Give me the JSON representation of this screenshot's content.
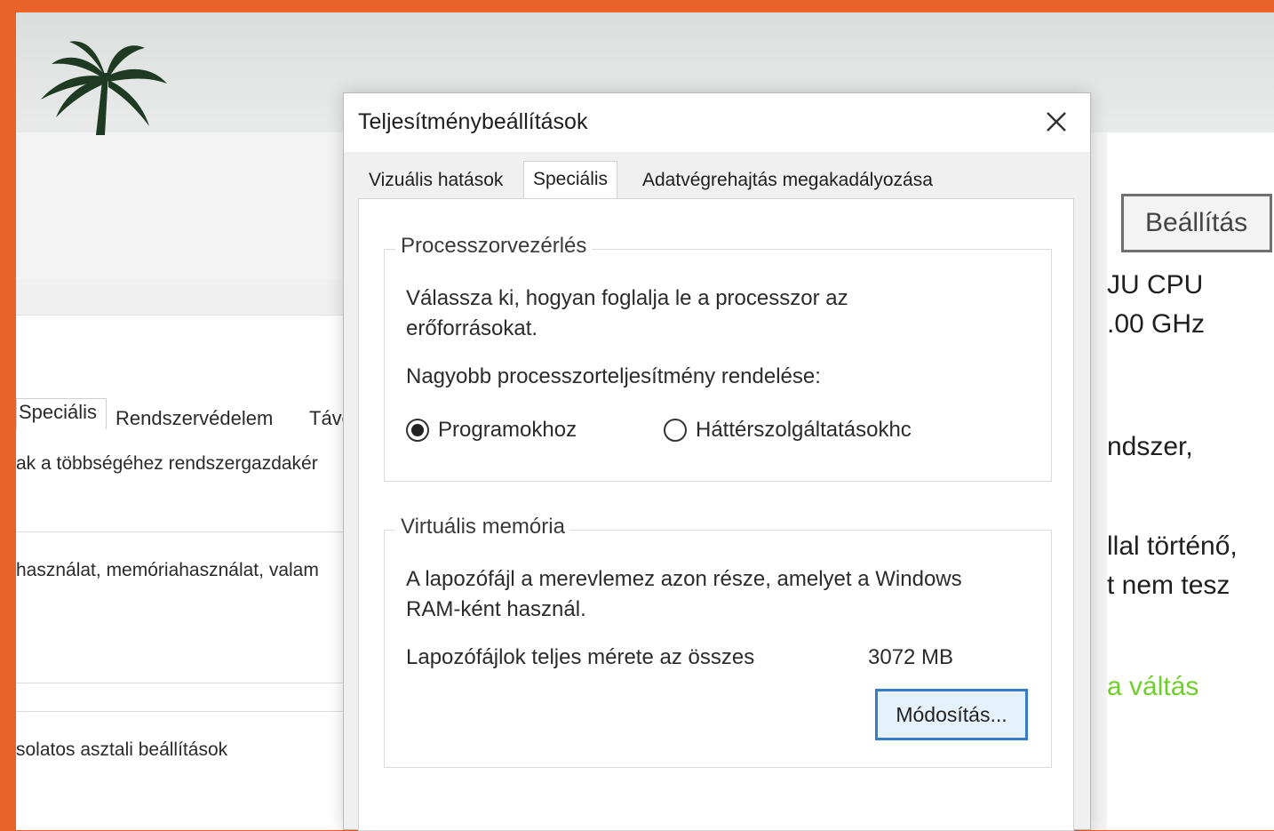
{
  "background": {
    "left_tabs": [
      "Speciális",
      "Rendszervédelem",
      "Távo"
    ],
    "left_lines": [
      "ak a többségéhez rendszergazdakér",
      "használat, memóriahasználat, valam",
      "solatos asztali beállítások"
    ],
    "right_button": "Beállítás",
    "right_lines": [
      "JU CPU",
      ".00 GHz",
      "ndszer,",
      "llal történő,",
      "t nem tesz",
      "a váltás"
    ],
    "accent_green": "#6fcf2a"
  },
  "dialog": {
    "title": "Teljesítménybeállítások",
    "tabs": [
      {
        "label": "Vizuális hatások",
        "active": false
      },
      {
        "label": "Speciális",
        "active": true
      },
      {
        "label": "Adatvégrehajtás megakadályozása",
        "active": false
      }
    ],
    "processor": {
      "legend": "Processzorvezérlés",
      "desc_line1": "Válassza ki, hogyan foglalja le a processzor az",
      "desc_line2": "erőforrásokat.",
      "question": "Nagyobb processzorteljesítmény rendelése:",
      "option_programs": "Programokhoz",
      "option_background": "Háttérszolgáltatásokhc",
      "selected": "Programokhoz"
    },
    "virtual_memory": {
      "legend": "Virtuális memória",
      "desc_line1": "A lapozófájl a merevlemez azon része, amelyet a Windows",
      "desc_line2": "RAM-ként használ.",
      "total_label": "Lapozófájlok teljes mérete az összes",
      "total_value": "3072  MB",
      "change_button": "Módosítás..."
    }
  }
}
